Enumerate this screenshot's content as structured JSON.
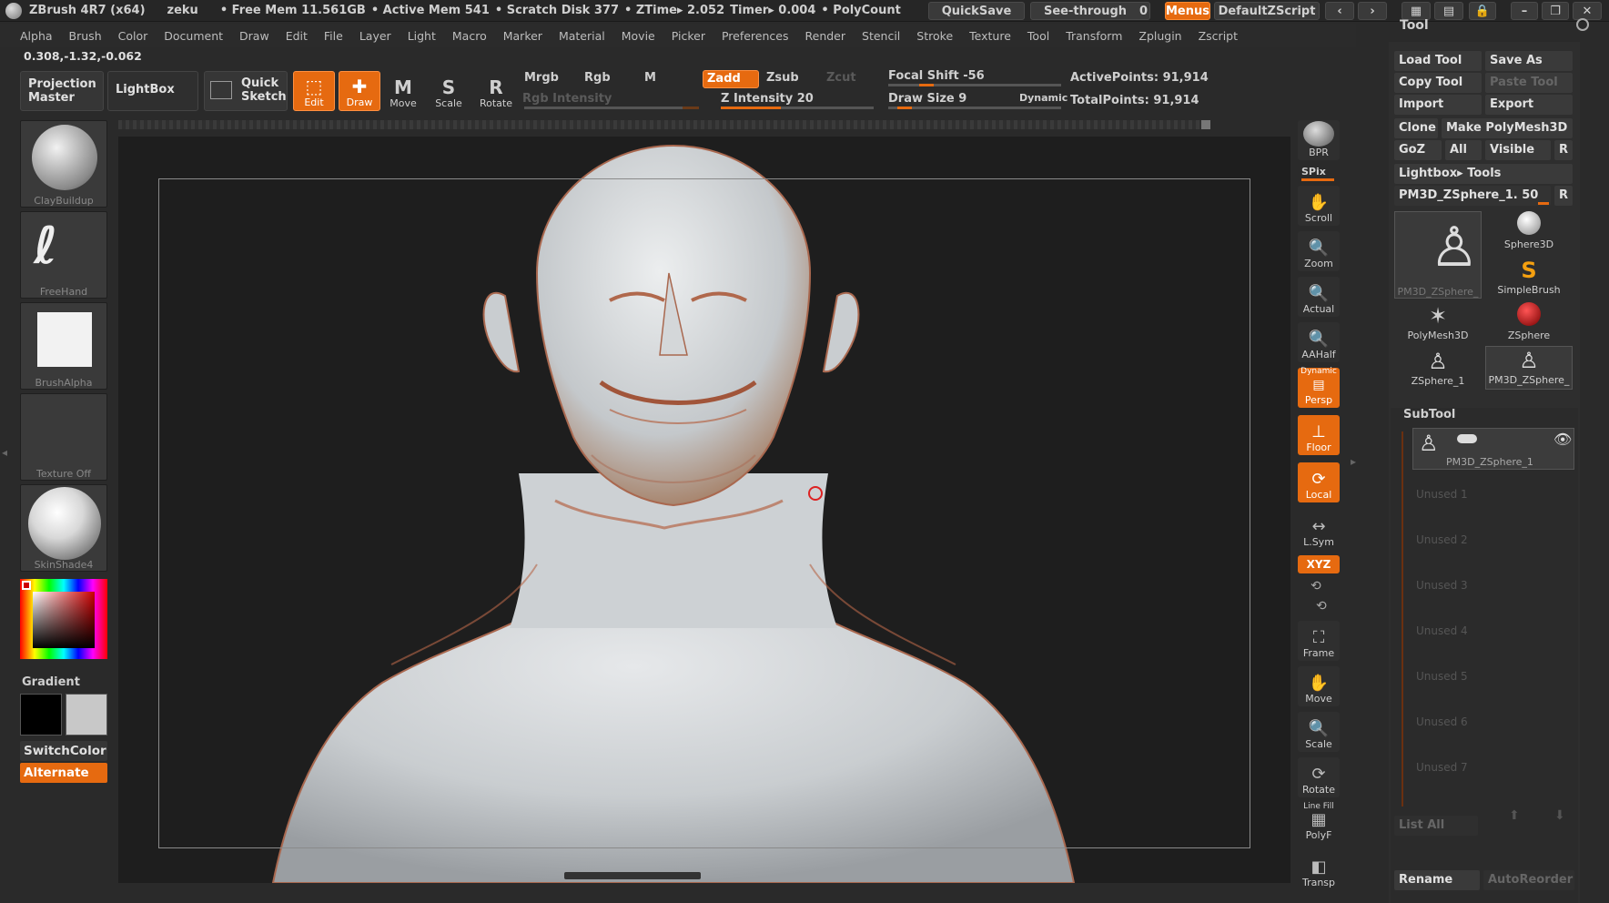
{
  "title_bar": {
    "app": "ZBrush 4R7 (x64)",
    "user": "zeku",
    "free_mem": "• Free Mem 11.561GB",
    "active_mem": "• Active Mem 541",
    "scratch_disk": "• Scratch Disk 377",
    "ztime": "• ZTime▸ 2.052",
    "timer": "Timer▸ 0.004",
    "polycount": "• PolyCount",
    "quicksave": "QuickSave",
    "see_through": "See-through",
    "see_through_value": "0",
    "menus": "Menus",
    "default_zscript": "DefaultZScript"
  },
  "menu": [
    "Alpha",
    "Brush",
    "Color",
    "Document",
    "Draw",
    "Edit",
    "File",
    "Layer",
    "Light",
    "Macro",
    "Marker",
    "Material",
    "Movie",
    "Picker",
    "Preferences",
    "Render",
    "Stencil",
    "Stroke",
    "Texture",
    "Tool",
    "Transform",
    "Zplugin",
    "Zscript"
  ],
  "coords": "0.308,-1.32,-0.062",
  "toolbar": {
    "projection_master": "Projection Master",
    "lightbox": "LightBox",
    "quick_sketch": "Quick Sketch",
    "edit": "Edit",
    "draw": "Draw",
    "move": "Move",
    "scale": "Scale",
    "rotate": "Rotate",
    "mrgb": "Mrgb",
    "rgb": "Rgb",
    "m": "M",
    "zadd": "Zadd",
    "zsub": "Zsub",
    "zcut": "Zcut",
    "rgb_intensity": "Rgb Intensity",
    "z_intensity": "Z Intensity 20",
    "focal_shift": "Focal Shift -56",
    "draw_size": "Draw Size 9",
    "dynamic": "Dynamic",
    "active_points": "ActivePoints: 91,914",
    "total_points": "TotalPoints: 91,914"
  },
  "left_panel": {
    "brush": "ClayBuildup",
    "stroke": "FreeHand",
    "alpha": "BrushAlpha",
    "texture": "Texture Off",
    "material": "SkinShade4",
    "gradient": "Gradient",
    "switch_color": "SwitchColor",
    "alternate": "Alternate"
  },
  "right_tools": {
    "bpr": "BPR",
    "spix": "SPix",
    "scroll": "Scroll",
    "zoom": "Zoom",
    "actual": "Actual",
    "aahalf": "AAHalf",
    "dynamic": "Dynamic",
    "persp": "Persp",
    "floor": "Floor",
    "local": "Local",
    "lsym": "L.Sym",
    "xyz": "XYZ",
    "frame": "Frame",
    "move": "Move",
    "scale": "Scale",
    "rotate": "Rotate",
    "line_fill": "Line Fill",
    "polyf": "PolyF",
    "transp": "Transp"
  },
  "tool_panel": {
    "header": "Tool",
    "load_tool": "Load Tool",
    "save_as": "Save As",
    "copy_tool": "Copy Tool",
    "paste_tool": "Paste Tool",
    "import": "Import",
    "export": "Export",
    "clone": "Clone",
    "make_polymesh": "Make PolyMesh3D",
    "goz": "GoZ",
    "all": "All",
    "visible": "Visible",
    "r": "R",
    "lightbox_tools": "Lightbox▸ Tools",
    "current_tool": "PM3D_ZSphere_1. 50",
    "tools": [
      "PM3D_ZSphere_",
      "Sphere3D",
      "SimpleBrush",
      "PolyMesh3D",
      "ZSphere",
      "ZSphere_1",
      "PM3D_ZSphere_"
    ]
  },
  "subtool": {
    "header": "SubTool",
    "item": "PM3D_ZSphere_1",
    "unused": [
      "Unused 1",
      "Unused 2",
      "Unused 3",
      "Unused 4",
      "Unused 5",
      "Unused 6",
      "Unused 7"
    ],
    "list_all": "List All",
    "rename": "Rename",
    "auto_reorder": "AutoReorder"
  },
  "colors": {
    "accent": "#e66a10",
    "background": "#2a2a2a",
    "viewport": "#1e1e1e",
    "skin": "#cfd3d6",
    "skin_shadow": "#b45a3c"
  }
}
